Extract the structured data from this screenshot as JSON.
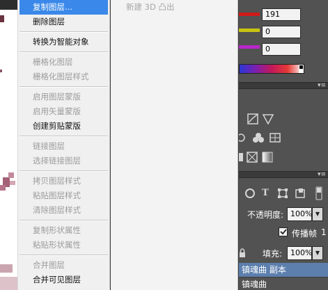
{
  "context_menu": {
    "items": [
      {
        "label": "复制图层...",
        "state": "highlighted"
      },
      {
        "label": "删除图层",
        "state": "enabled"
      },
      {
        "sep": true
      },
      {
        "label": "转换为智能对象",
        "state": "enabled"
      },
      {
        "sep": true
      },
      {
        "label": "栅格化图层",
        "state": "disabled"
      },
      {
        "label": "栅格化图层样式",
        "state": "disabled"
      },
      {
        "sep": true
      },
      {
        "label": "启用图层蒙版",
        "state": "disabled"
      },
      {
        "label": "启用矢量蒙版",
        "state": "disabled"
      },
      {
        "label": "创建剪贴蒙版",
        "state": "enabled"
      },
      {
        "sep": true
      },
      {
        "label": "链接图层",
        "state": "disabled"
      },
      {
        "label": "选择链接图层",
        "state": "disabled"
      },
      {
        "sep": true
      },
      {
        "label": "拷贝图层样式",
        "state": "disabled"
      },
      {
        "label": "粘贴图层样式",
        "state": "disabled"
      },
      {
        "label": "清除图层样式",
        "state": "disabled"
      },
      {
        "sep": true
      },
      {
        "label": "复制形状属性",
        "state": "disabled"
      },
      {
        "label": "粘贴形状属性",
        "state": "disabled"
      },
      {
        "sep": true
      },
      {
        "label": "合并图层",
        "state": "disabled"
      },
      {
        "label": "合并可见图层",
        "state": "enabled"
      }
    ]
  },
  "secondary_panel": {
    "item": "新建 3D 凸出"
  },
  "color_panel": {
    "r": "191",
    "g": "0",
    "b": "0",
    "r_color": "#d01a1a",
    "g_color": "#c9c412",
    "b_color": "#b528c8"
  },
  "adjustments_icons": [
    "curves-icon",
    "triangle-icon",
    "channel-mixer-icon",
    "color-balance-icon",
    "grid-icon",
    "invert-icon",
    "gradient-map-icon"
  ],
  "layers_panel": {
    "filter_icons": [
      "circle-icon",
      "text-icon",
      "transform-icon",
      "smart-object-icon",
      "toggle-icon"
    ],
    "opacity_label": "不透明度:",
    "opacity_value": "100%",
    "propagate_label": "传播帧",
    "propagate_value": "1",
    "fill_label": "填充:",
    "fill_value": "100%",
    "layers": [
      {
        "name": "镇魂曲 副本",
        "selected": true
      },
      {
        "name": "镇魂曲",
        "selected": false
      }
    ]
  },
  "colors": {
    "menu_highlight": "#3a88e9",
    "panel_bg": "#525252",
    "layer_selected": "#5d7fae"
  }
}
